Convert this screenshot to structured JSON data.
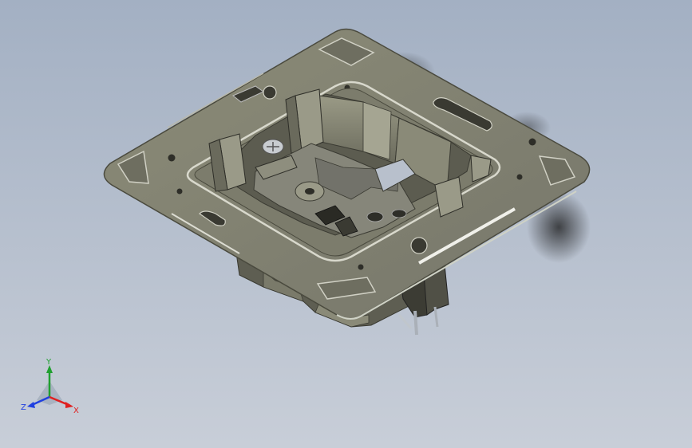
{
  "viewport": {
    "background_top": "#a3b0c3",
    "background_bottom": "#c8ced8"
  },
  "model": {
    "plate_color": "#82826f",
    "plate_edge_color": "#4a4a3e",
    "highlight_color": "#d8d8cc"
  },
  "triad": {
    "x_label": "X",
    "y_label": "Y",
    "z_label": "Z",
    "x_color": "#e02020",
    "y_color": "#20a030",
    "z_color": "#2040e0"
  }
}
